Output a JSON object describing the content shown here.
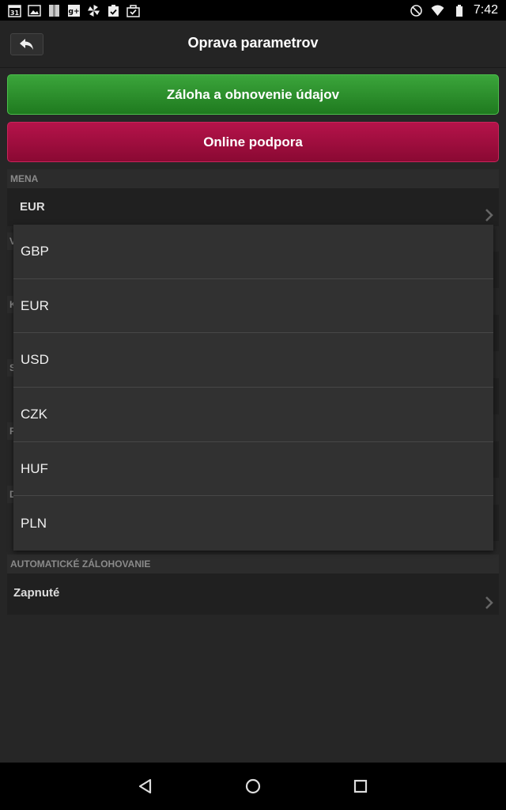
{
  "status_bar": {
    "time": "7:42",
    "calendar_day": "31",
    "left_icons": [
      "calendar-icon",
      "image-icon",
      "bookmark-icon",
      "google-plus-icon",
      "pinwheel-icon",
      "clipboard-check-icon",
      "briefcase-check-icon"
    ],
    "right_icons": [
      "do-not-disturb-icon",
      "wifi-icon",
      "battery-icon"
    ]
  },
  "header": {
    "title": "Oprava parametrov",
    "back_icon": "back-arrow-icon"
  },
  "buttons": {
    "backup": {
      "label": "Záloha a obnovenie údajov",
      "color": "#2e8f2e"
    },
    "support": {
      "label": "Online podpora",
      "color": "#a10f40"
    }
  },
  "settings": {
    "currency_section": "MENA",
    "currency_value": "EUR",
    "autobackup_section": "AUTOMATICKÉ ZÁLOHOVANIE",
    "autobackup_value": "Zapnuté"
  },
  "background_stubs": [
    "V",
    "K",
    "S",
    "P",
    "D"
  ],
  "currency_popup": {
    "options": [
      "GBP",
      "EUR",
      "USD",
      "CZK",
      "HUF",
      "PLN"
    ]
  },
  "nav_bar": {
    "icons": [
      "back-triangle-icon",
      "home-circle-icon",
      "recents-square-icon"
    ]
  }
}
